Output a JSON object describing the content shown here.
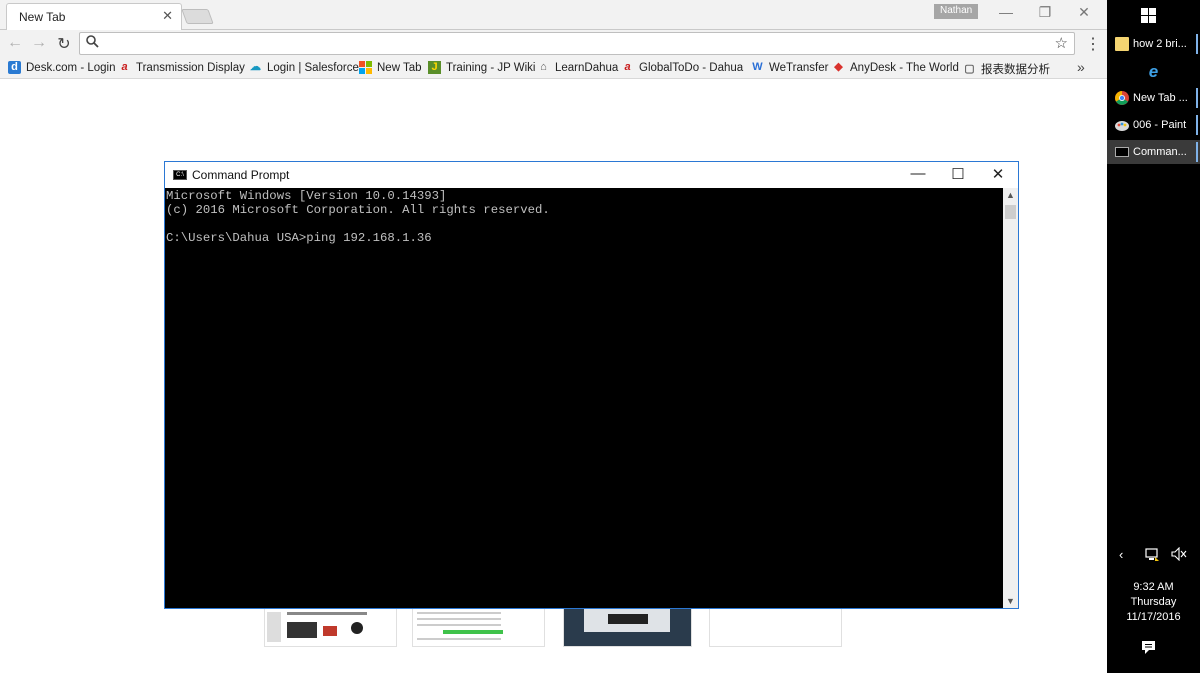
{
  "browser": {
    "tab_title": "New Tab",
    "tab_close": "✕",
    "profile_name": "Nathan",
    "window_controls": {
      "minimize": "—",
      "restore": "❐",
      "close": "✕"
    },
    "omnibox_value": "",
    "icons": {
      "back": "back-arrow-icon",
      "forward": "forward-arrow-icon",
      "reload": "reload-icon",
      "search": "search-icon",
      "star": "star-icon",
      "menu": "kebab-menu-icon"
    }
  },
  "bookmarks": [
    {
      "label": "Desk.com - Login",
      "icon": "d",
      "color": "#2a7ad2"
    },
    {
      "label": "Transmission Display",
      "icon": "a",
      "color": "#c91c1c"
    },
    {
      "label": "Login | Salesforce",
      "icon": "☁",
      "color": "#1798c1"
    },
    {
      "label": "New Tab",
      "icon": "▦",
      "color": "#e74c3c"
    },
    {
      "label": "Training - JP Wiki",
      "icon": "J",
      "color": "#5b8f2a"
    },
    {
      "label": "LearnDahua",
      "icon": "⌂",
      "color": "#555555"
    },
    {
      "label": "GlobalToDo - Dahua",
      "icon": "a",
      "color": "#c91c1c"
    },
    {
      "label": "WeTransfer",
      "icon": "W",
      "color": "#2a6fd6"
    },
    {
      "label": "AnyDesk - The World",
      "icon": "◆",
      "color": "#d9322d"
    },
    {
      "label": "报表数据分析",
      "icon": "▢",
      "color": "#666666"
    }
  ],
  "bookmarks_more": "»",
  "cmd": {
    "title": "Command Prompt",
    "lines": [
      "Microsoft Windows [Version 10.0.14393]",
      "(c) 2016 Microsoft Corporation. All rights reserved.",
      "",
      "C:\\Users\\Dahua USA>ping 192.168.1.36"
    ],
    "controls": {
      "minimize": "—",
      "maximize": "☐",
      "close": "✕"
    }
  },
  "taskbar": {
    "items": [
      {
        "label": "how 2 bri...",
        "icon": "folder-icon",
        "active": false
      },
      {
        "label": "",
        "icon": "internet-explorer-icon",
        "active": false
      },
      {
        "label": "New Tab ...",
        "icon": "chrome-icon",
        "active": false
      },
      {
        "label": "006 - Paint",
        "icon": "paint-icon",
        "active": false
      },
      {
        "label": "Comman...",
        "icon": "cmd-icon",
        "active": true
      }
    ],
    "clock": {
      "time": "9:32 AM",
      "day": "Thursday",
      "date": "11/17/2016"
    }
  }
}
